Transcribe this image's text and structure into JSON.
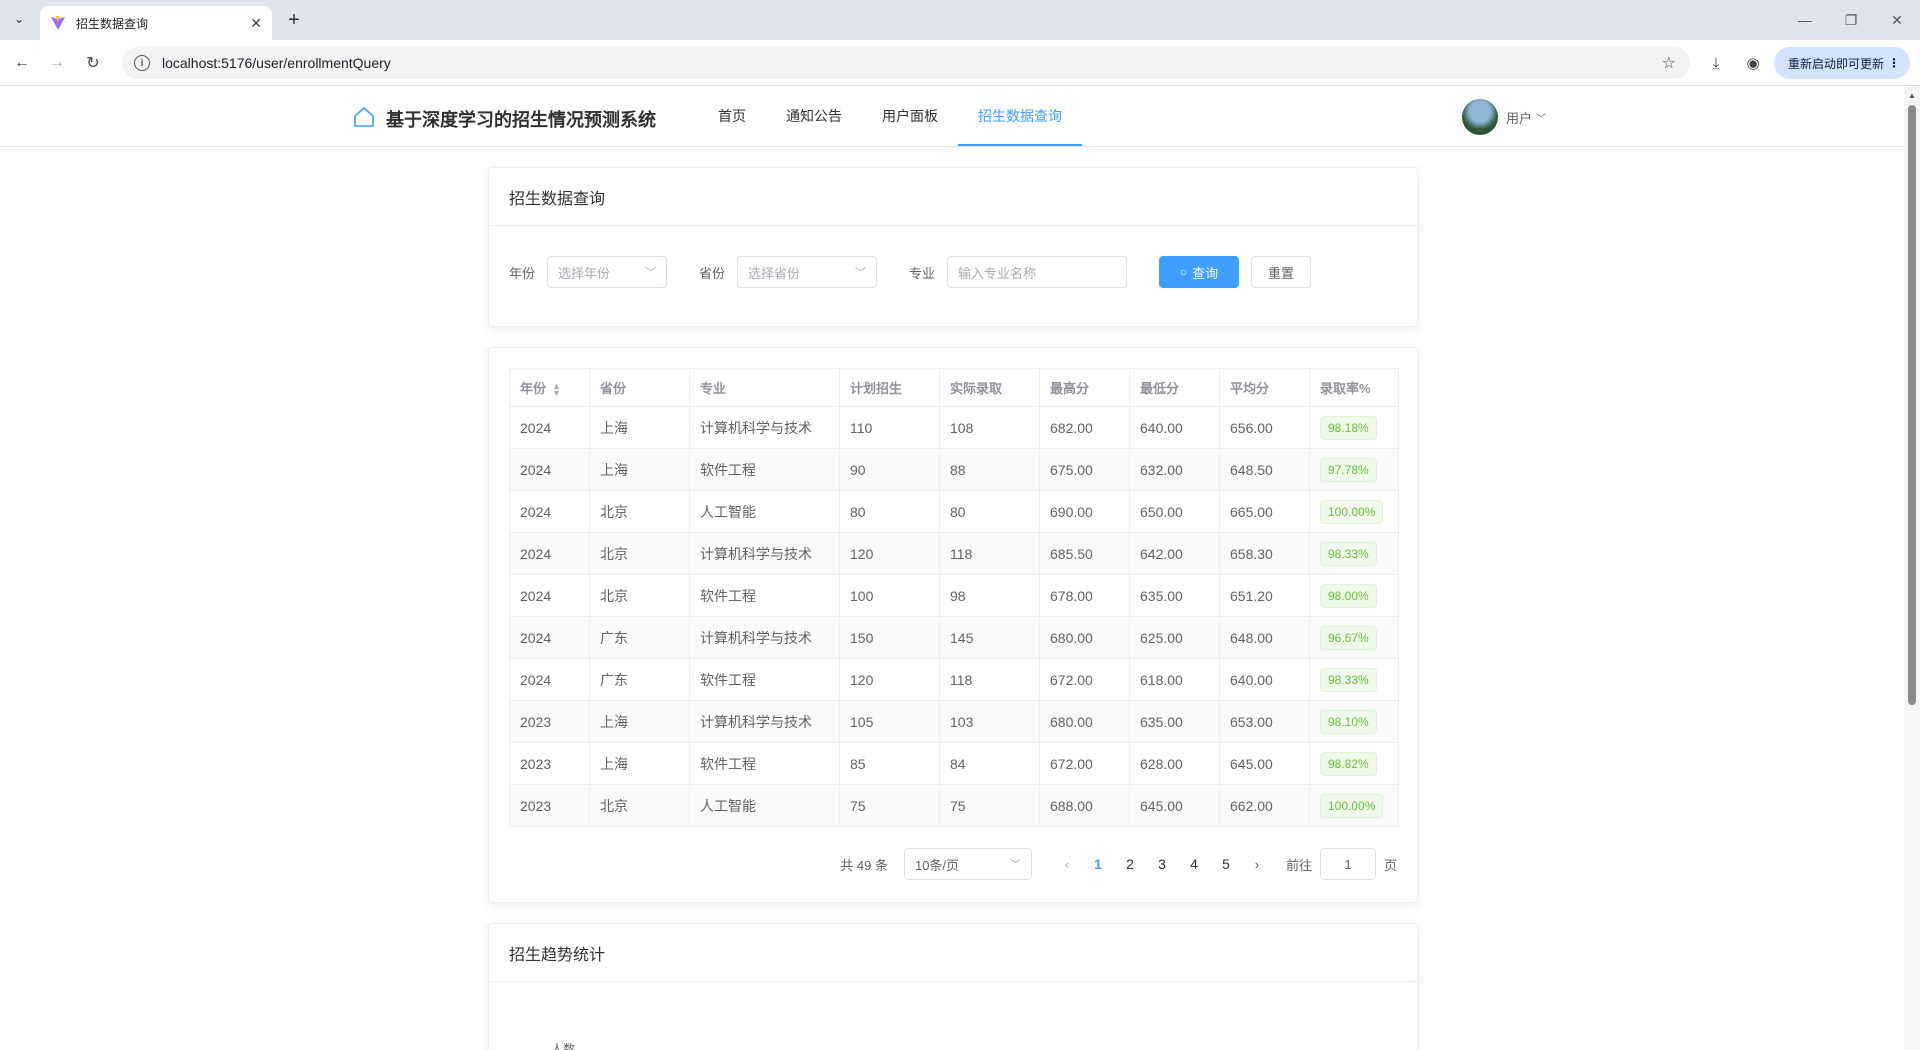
{
  "browser": {
    "tab_title": "招生数据查询",
    "url": "localhost:5176/user/enrollmentQuery",
    "update_label": "重新启动即可更新"
  },
  "header": {
    "brand": "基于深度学习的招生情况预测系统",
    "nav": [
      "首页",
      "通知公告",
      "用户面板",
      "招生数据查询"
    ],
    "active_nav": "招生数据查询",
    "user_label": "用户"
  },
  "query_card": {
    "title": "招生数据查询",
    "year_label": "年份",
    "year_placeholder": "选择年份",
    "province_label": "省份",
    "province_placeholder": "选择省份",
    "major_label": "专业",
    "major_placeholder": "输入专业名称",
    "search_label": "查询",
    "reset_label": "重置"
  },
  "table": {
    "columns": [
      "年份",
      "省份",
      "专业",
      "计划招生",
      "实际录取",
      "最高分",
      "最低分",
      "平均分",
      "录取率%"
    ],
    "rows": [
      [
        "2024",
        "上海",
        "计算机科学与技术",
        "110",
        "108",
        "682.00",
        "640.00",
        "656.00",
        "98.18%"
      ],
      [
        "2024",
        "上海",
        "软件工程",
        "90",
        "88",
        "675.00",
        "632.00",
        "648.50",
        "97.78%"
      ],
      [
        "2024",
        "北京",
        "人工智能",
        "80",
        "80",
        "690.00",
        "650.00",
        "665.00",
        "100.00%"
      ],
      [
        "2024",
        "北京",
        "计算机科学与技术",
        "120",
        "118",
        "685.50",
        "642.00",
        "658.30",
        "98.33%"
      ],
      [
        "2024",
        "北京",
        "软件工程",
        "100",
        "98",
        "678.00",
        "635.00",
        "651.20",
        "98.00%"
      ],
      [
        "2024",
        "广东",
        "计算机科学与技术",
        "150",
        "145",
        "680.00",
        "625.00",
        "648.00",
        "96.67%"
      ],
      [
        "2024",
        "广东",
        "软件工程",
        "120",
        "118",
        "672.00",
        "618.00",
        "640.00",
        "98.33%"
      ],
      [
        "2023",
        "上海",
        "计算机科学与技术",
        "105",
        "103",
        "680.00",
        "635.00",
        "653.00",
        "98.10%"
      ],
      [
        "2023",
        "上海",
        "软件工程",
        "85",
        "84",
        "672.00",
        "628.00",
        "645.00",
        "98.82%"
      ],
      [
        "2023",
        "北京",
        "人工智能",
        "75",
        "75",
        "688.00",
        "645.00",
        "662.00",
        "100.00%"
      ]
    ]
  },
  "pagination": {
    "total": "共 49 条",
    "page_size": "10条/页",
    "pages": [
      "1",
      "2",
      "3",
      "4",
      "5"
    ],
    "current": "1",
    "goto_label": "前往",
    "goto_value": "1",
    "page_suffix": "页"
  },
  "trend_card": {
    "title": "招生趋势统计",
    "y_axis_label": "人数"
  },
  "colors": {
    "primary": "#409eff",
    "success": "#67c23a"
  }
}
